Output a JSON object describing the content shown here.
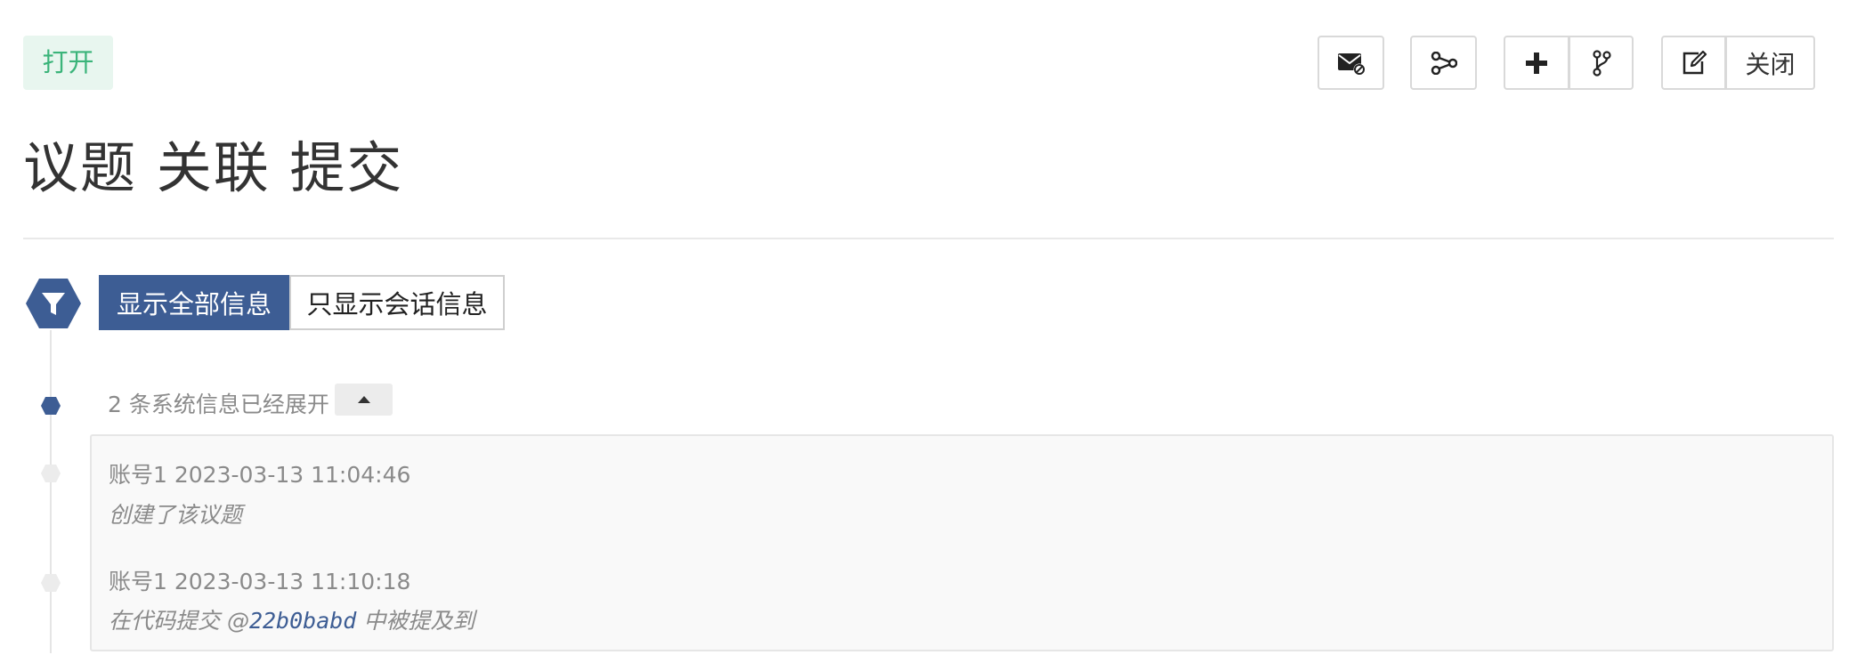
{
  "status": {
    "label": "打开"
  },
  "toolbar": {
    "close_label": "关闭",
    "icons": [
      "envelope-mute-icon",
      "share-nodes-icon",
      "plus-icon",
      "code-branch-icon",
      "edit-icon"
    ]
  },
  "title": "议题 关联 提交",
  "filter": {
    "show_all_label": "显示全部信息",
    "show_comments_label": "只显示会话信息"
  },
  "timeline": {
    "expanded_text": "2 条系统信息已经展开",
    "entries": [
      {
        "author": "账号1",
        "time": "2023-03-13 11:04:46",
        "text": "创建了该议题"
      },
      {
        "author": "账号1",
        "time": "2023-03-13 11:10:18",
        "text_prefix": "在代码提交 @",
        "commit": "22b0babd",
        "text_suffix": " 中被提及到"
      }
    ]
  },
  "colors": {
    "accent": "#3d5d94",
    "status_green": "#3bb47a",
    "status_green_bg": "#e8f6ef"
  }
}
